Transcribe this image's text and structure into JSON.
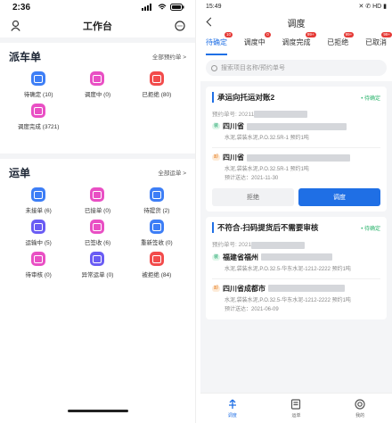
{
  "left": {
    "status_time": "2:36",
    "title": "工作台",
    "sections": [
      {
        "title": "派车单",
        "more": "全部预约单 >",
        "items": [
          {
            "label": "待确定 (10)",
            "color": "#3d7ef6"
          },
          {
            "label": "调度中 (0)",
            "color": "#e94fc4"
          },
          {
            "label": "已拒绝 (80)",
            "color": "#f24b4b"
          },
          {
            "label": "调度完成 (3721)",
            "color": "#e94fc4"
          }
        ]
      },
      {
        "title": "运单",
        "more": "全部运单 >",
        "items": [
          {
            "label": "未接单 (6)",
            "color": "#3d7ef6"
          },
          {
            "label": "已接单 (0)",
            "color": "#e94fc4"
          },
          {
            "label": "待提货 (2)",
            "color": "#3d7ef6"
          },
          {
            "label": "运输中 (5)",
            "color": "#6a5cf4"
          },
          {
            "label": "已签收 (6)",
            "color": "#e94fc4"
          },
          {
            "label": "重新签收 (0)",
            "color": "#3d7ef6"
          },
          {
            "label": "待审核 (0)",
            "color": "#e94fc4"
          },
          {
            "label": "异常运单 (0)",
            "color": "#6a5cf4"
          },
          {
            "label": "被拒绝 (84)",
            "color": "#f24b4b"
          }
        ]
      }
    ]
  },
  "right": {
    "status_time": "15:49",
    "status_icons": "✕ ✆ HD ▮",
    "title": "调度",
    "tabs": [
      {
        "label": "待确定",
        "badge": "10"
      },
      {
        "label": "调度中",
        "badge": "0"
      },
      {
        "label": "调度完成",
        "badge": "99+"
      },
      {
        "label": "已拒绝",
        "badge": "99+"
      },
      {
        "label": "已取消",
        "badge": "99+"
      }
    ],
    "search_placeholder": "搜索项目名称/预约单号",
    "cards": [
      {
        "title": "承运向托运对账2",
        "status": "• 待确定",
        "order_prefix": "预约单号: 20211",
        "stops": [
          {
            "tag": "装",
            "place": "四川省",
            "cargo": "水泥,袋装水泥,P.O.32.5R-1 预约1吨",
            "date": ""
          },
          {
            "tag": "卸",
            "place": "四川省",
            "cargo": "水泥,袋装水泥,P.O.32.5R-1 预约1吨",
            "date": "预计送达：2021-11-30"
          }
        ],
        "reject": "拒绝",
        "dispatch": "调度"
      },
      {
        "title": "不符合-扫码提货后不需要审核",
        "status": "• 待确定",
        "order_prefix": "预约单号: 2021",
        "stops": [
          {
            "tag": "装",
            "place": "福建省福州",
            "cargo": "水泥,袋装水泥,P.O.32.5-华东水泥-1212-2222 预约1吨",
            "date": ""
          },
          {
            "tag": "卸",
            "place": "四川省成都市",
            "cargo": "水泥,袋装水泥,P.O.32.5-华东水泥-1212-2222 预约1吨",
            "date": "预计送达：2021-06-09"
          }
        ]
      }
    ],
    "tabbar": [
      {
        "label": "调度",
        "icon": "dispatch-icon"
      },
      {
        "label": "运单",
        "icon": "waybill-icon"
      },
      {
        "label": "我的",
        "icon": "profile-icon"
      }
    ]
  }
}
